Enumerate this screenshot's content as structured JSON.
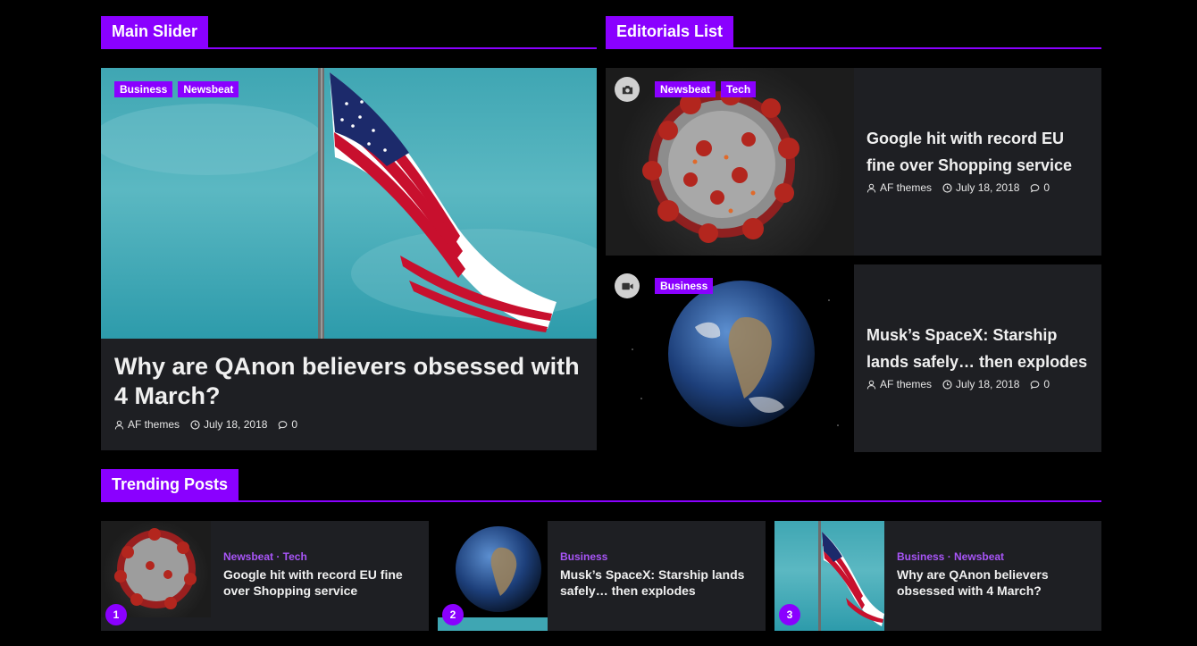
{
  "sections": {
    "main_slider": "Main Slider",
    "editorials": "Editorials List",
    "trending": "Trending Posts"
  },
  "main_slider": {
    "tags": [
      "Business",
      "Newsbeat"
    ],
    "title": "Why are QAnon believers obsessed with 4 March?",
    "author": "AF themes",
    "date": "July 18, 2018",
    "comments": "0",
    "image": "us-flag-photo"
  },
  "editorials": [
    {
      "tags": [
        "Newsbeat",
        "Tech"
      ],
      "media_icon": "camera-icon",
      "image": "coronavirus-illustration",
      "title": "Google hit with record EU fine over Shopping service",
      "author": "AF themes",
      "date": "July 18, 2018",
      "comments": "0"
    },
    {
      "tags": [
        "Business"
      ],
      "media_icon": "video-camera-icon",
      "image": "earth-from-space",
      "title": "Musk’s SpaceX: Starship lands safely… then explodes",
      "author": "AF themes",
      "date": "July 18, 2018",
      "comments": "0"
    }
  ],
  "trending": [
    {
      "num": "1",
      "cats": "Newsbeat · Tech",
      "title": "Google hit with record EU fine over Shopping service",
      "image": "coronavirus-illustration"
    },
    {
      "num": "2",
      "cats": "Business",
      "title": "Musk’s SpaceX: Starship lands safely… then explodes",
      "image": "earth-from-space"
    },
    {
      "num": "3",
      "cats": "Business · Newsbeat",
      "title": "Why are QAnon believers obsessed with 4 March?",
      "image": "us-flag-photo"
    }
  ],
  "colors": {
    "accent": "#8a00ff",
    "card_bg": "#1e1f23",
    "page_bg": "#000000",
    "category_text": "#a855f7"
  }
}
